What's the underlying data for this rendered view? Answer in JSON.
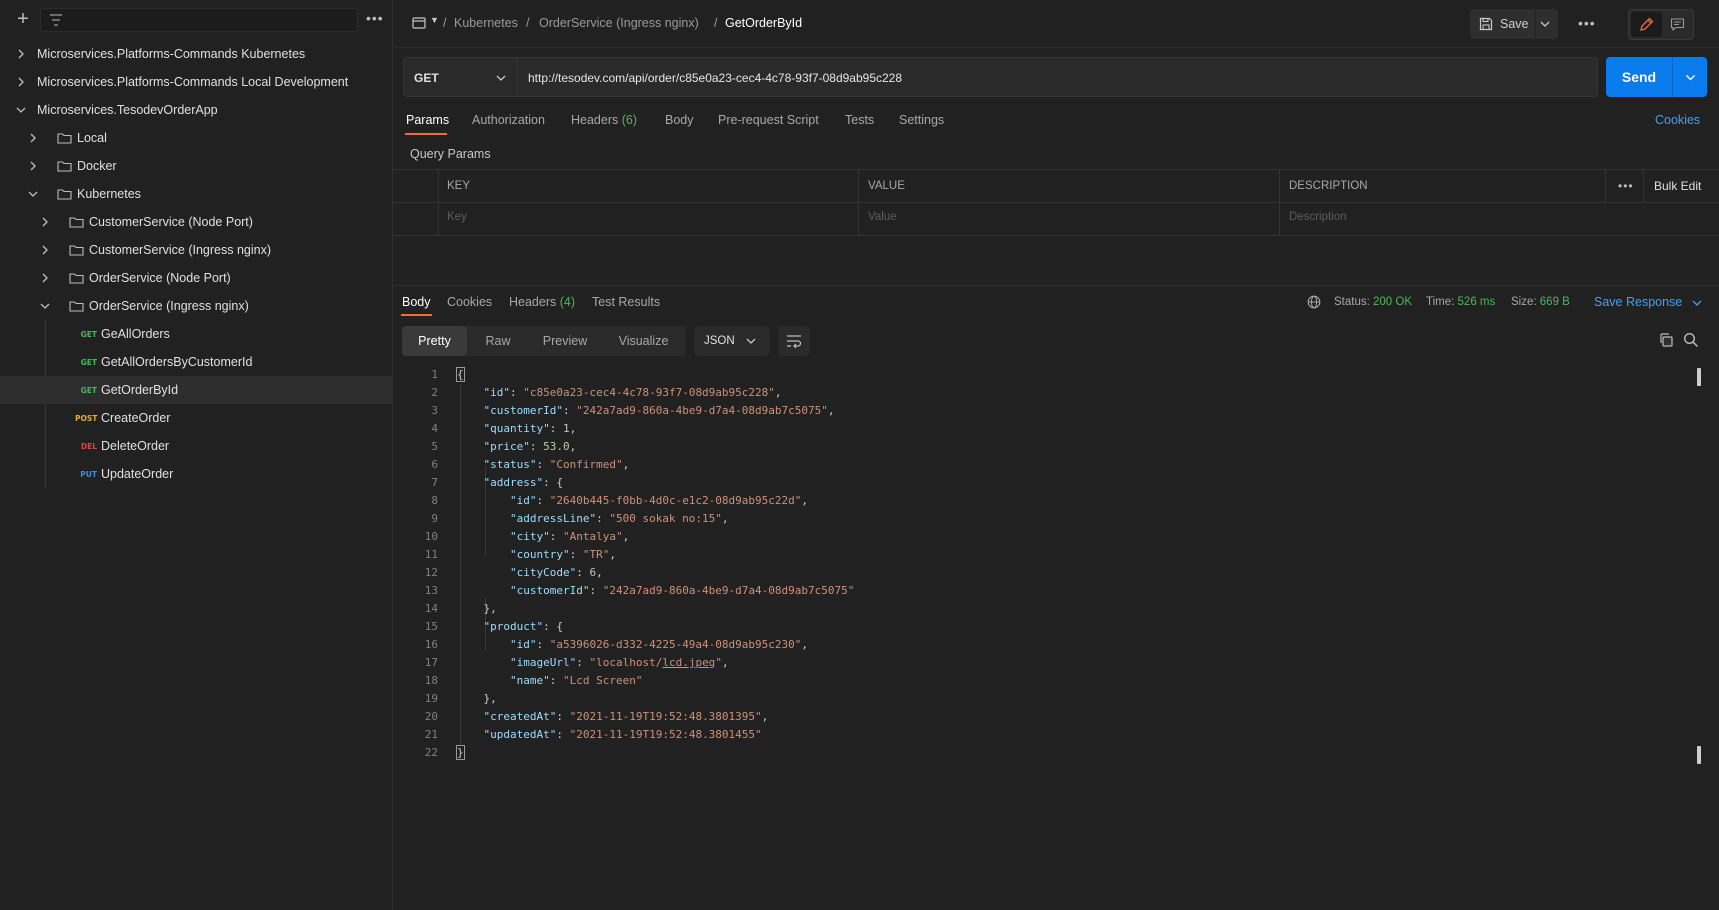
{
  "sidebar": {
    "items": [
      {
        "label": "Microservices.Platforms-Commands Kubernetes",
        "type": "collection",
        "expanded": false
      },
      {
        "label": "Microservices.Platforms-Commands Local Development",
        "type": "collection",
        "expanded": false
      },
      {
        "label": "Microservices.TesodevOrderApp",
        "type": "collection",
        "expanded": true
      },
      {
        "label": "Local",
        "type": "folder",
        "expanded": false
      },
      {
        "label": "Docker",
        "type": "folder",
        "expanded": false
      },
      {
        "label": "Kubernetes",
        "type": "folder",
        "expanded": true
      },
      {
        "label": "CustomerService (Node Port)",
        "type": "folder",
        "expanded": false
      },
      {
        "label": "CustomerService (Ingress nginx)",
        "type": "folder",
        "expanded": false
      },
      {
        "label": "OrderService (Node Port)",
        "type": "folder",
        "expanded": false
      },
      {
        "label": "OrderService (Ingress nginx)",
        "type": "folder",
        "expanded": true
      },
      {
        "label": "GeAllOrders",
        "type": "request",
        "method": "GET"
      },
      {
        "label": "GetAllOrdersByCustomerId",
        "type": "request",
        "method": "GET"
      },
      {
        "label": "GetOrderById",
        "type": "request",
        "method": "GET",
        "selected": true
      },
      {
        "label": "CreateOrder",
        "type": "request",
        "method": "POST"
      },
      {
        "label": "DeleteOrder",
        "type": "request",
        "method": "DEL"
      },
      {
        "label": "UpdateOrder",
        "type": "request",
        "method": "PUT"
      }
    ]
  },
  "header": {
    "breadcrumb": [
      "Kubernetes",
      "OrderService (Ingress nginx)",
      "GetOrderById"
    ],
    "separator": "/",
    "save_label": "Save"
  },
  "request": {
    "method": "GET",
    "url": "http://tesodev.com/api/order/c85e0a23-cec4-4c78-93f7-08d9ab95c228",
    "send_label": "Send",
    "tabs": {
      "params": "Params",
      "authorization": "Authorization",
      "headers": "Headers",
      "headers_count": "(6)",
      "body": "Body",
      "prerequest": "Pre-request Script",
      "tests": "Tests",
      "settings": "Settings"
    },
    "active_tab": "Params",
    "cookies_label": "Cookies",
    "query_params_title": "Query Params",
    "params_table": {
      "columns": [
        "KEY",
        "VALUE",
        "DESCRIPTION"
      ],
      "placeholders": [
        "Key",
        "Value",
        "Description"
      ],
      "bulk_edit_label": "Bulk Edit"
    }
  },
  "response": {
    "tabs": {
      "body": "Body",
      "cookies": "Cookies",
      "headers": "Headers",
      "headers_count": "(4)",
      "test_results": "Test Results"
    },
    "status_label": "Status:",
    "status_value": "200 OK",
    "time_label": "Time:",
    "time_value": "526 ms",
    "size_label": "Size:",
    "size_value": "669 B",
    "save_response_label": "Save Response",
    "views": [
      "Pretty",
      "Raw",
      "Preview",
      "Visualize"
    ],
    "active_view": "Pretty",
    "language": "JSON",
    "line_numbers": [
      "1",
      "2",
      "3",
      "4",
      "5",
      "6",
      "7",
      "8",
      "9",
      "10",
      "11",
      "12",
      "13",
      "14",
      "15",
      "16",
      "17",
      "18",
      "19",
      "20",
      "21",
      "22"
    ],
    "body_json": {
      "id": "c85e0a23-cec4-4c78-93f7-08d9ab95c228",
      "customerId": "242a7ad9-860a-4be9-d7a4-08d9ab7c5075",
      "quantity": "1",
      "price": "53.0",
      "status": "Confirmed",
      "address": {
        "id": "2640b445-f0bb-4d0c-e1c2-08d9ab95c22d",
        "addressLine": "500 sokak no:15",
        "city": "Antalya",
        "country": "TR",
        "cityCode": "6",
        "customerId": "242a7ad9-860a-4be9-d7a4-08d9ab7c5075"
      },
      "product": {
        "id": "a5396026-d332-4225-49a4-08d9ab95c230",
        "imageUrl_prefix": "localhost/",
        "imageUrl_link": "lcd.jpeg",
        "name": "Lcd Screen"
      },
      "createdAt": "2021-11-19T19:52:48.3801395",
      "updatedAt": "2021-11-19T19:52:48.3801455"
    }
  },
  "colors": {
    "accent_blue": "#097bed",
    "tab_underline": "#f26b3a",
    "get": "#49b955",
    "post": "#e8a93b",
    "delete": "#e34242",
    "put": "#3b8de0",
    "status_ok": "#49b955"
  },
  "icons": [
    "plus-icon",
    "filter-icon",
    "more-icon",
    "chevron-right-icon",
    "chevron-down-icon",
    "folder-icon",
    "collection-icon",
    "save-icon",
    "edit-icon",
    "comment-icon",
    "globe-icon",
    "copy-icon",
    "search-icon",
    "wrap-lines-icon"
  ]
}
